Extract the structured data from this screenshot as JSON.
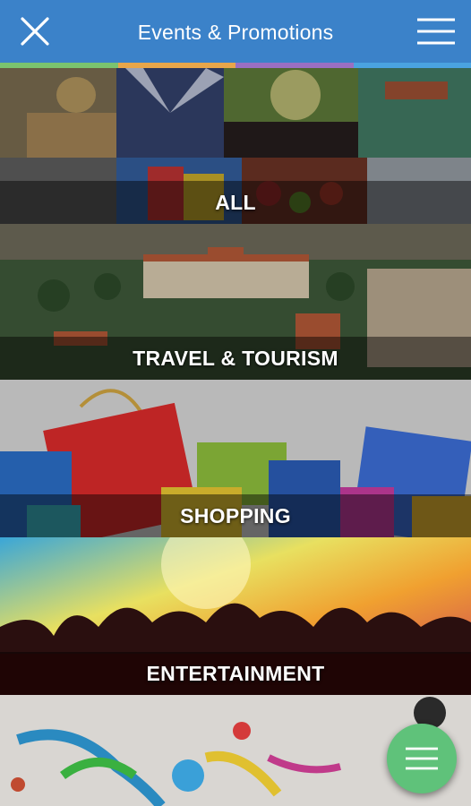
{
  "header": {
    "title": "Events & Promotions",
    "background": "#3b82c9"
  },
  "accent_stripe": [
    "#7bc36f",
    "#e8a64a",
    "#9a6fc2",
    "#4aa3e0"
  ],
  "categories": [
    {
      "label": "ALL"
    },
    {
      "label": "TRAVEL & TOURISM"
    },
    {
      "label": "SHOPPING"
    },
    {
      "label": "ENTERTAINMENT"
    }
  ],
  "fab": {
    "icon": "hamburger-icon",
    "color": "#5fc27a"
  }
}
